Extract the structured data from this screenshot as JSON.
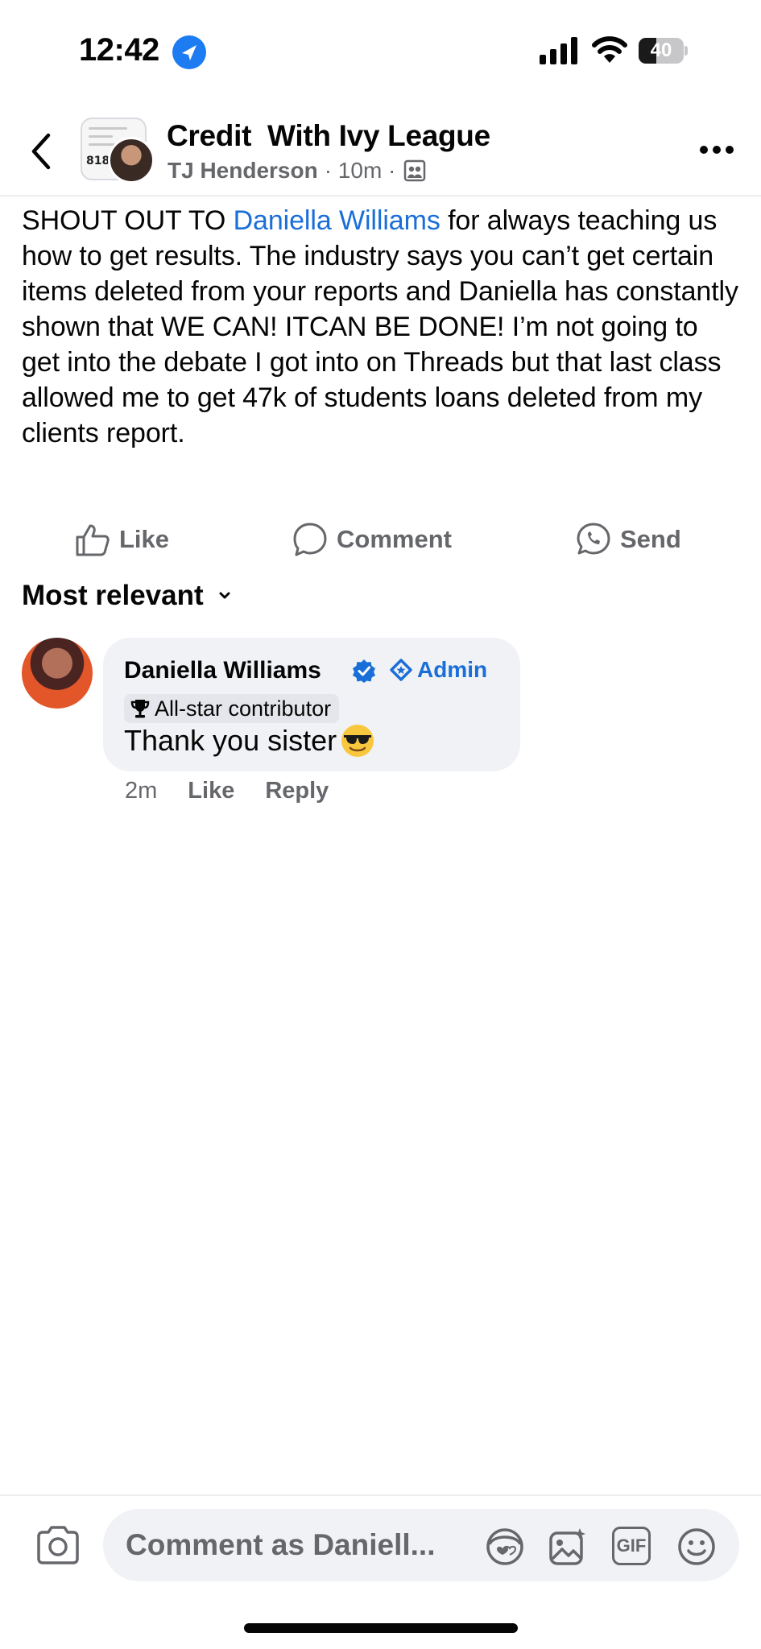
{
  "status_bar": {
    "time": "12:42",
    "battery_percent": "40",
    "battery_level": 0.4
  },
  "header": {
    "group_name": "Credit  With Ivy League",
    "author": "TJ Henderson",
    "time": "· 10m ·",
    "group_thumb_score": "818",
    "icons": [
      "back-chevron-icon",
      "members-icon",
      "more-icon"
    ]
  },
  "post": {
    "text_before": "SHOUT OUT TO ",
    "mention": "Daniella Williams",
    "text_after": " for always teaching us how to get results. The industry says you can’t get certain items deleted from your reports and Daniella has constantly shown that WE CAN! ITCAN BE DONE! I’m not going to get into the debate I got into on Threads but that last class allowed me to get 47k of students loans deleted from my clients report."
  },
  "actions": {
    "like": "Like",
    "comment": "Comment",
    "send": "Send"
  },
  "comments_sort": {
    "label": "Most relevant"
  },
  "comment": {
    "author": "Daniella Williams",
    "admin_label": "Admin",
    "badge": "All-star contributor",
    "text": "Thank you sister",
    "emoji": "smiling-face-with-sunglasses",
    "timestamp": "2m",
    "like": "Like",
    "reply": "Reply"
  },
  "composer": {
    "placeholder": "Comment as Daniell...",
    "gif_label": "GIF",
    "icons": [
      "camera-icon",
      "avatar-sticker-icon",
      "photo-icon",
      "gif-icon",
      "emoji-icon"
    ]
  },
  "colors": {
    "link_blue": "#1a6ed8",
    "secondary_text": "#65676b",
    "bubble_bg": "#f0f2f5"
  }
}
